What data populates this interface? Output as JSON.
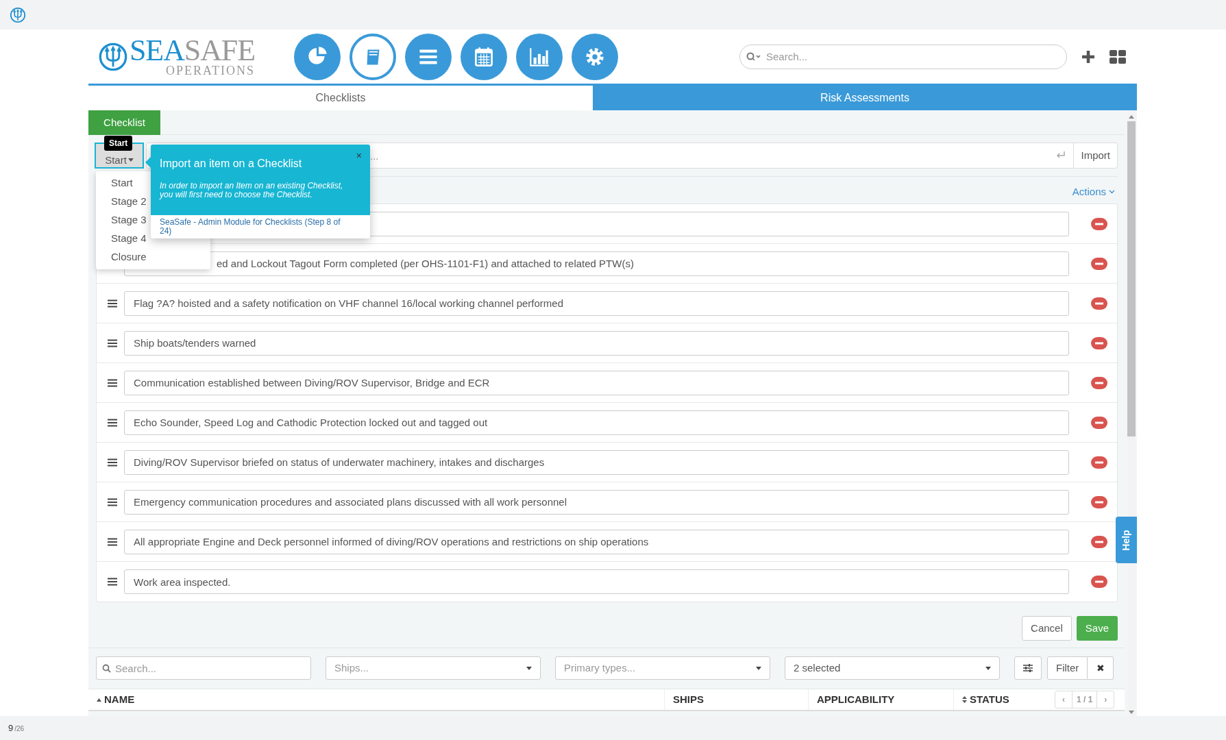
{
  "brand": {
    "name_part_1": "SEA",
    "name_part_2": "SAFE",
    "tagline": "OPERATIONS"
  },
  "search": {
    "placeholder": "Search..."
  },
  "tabs": [
    {
      "label": "Checklists",
      "selected": true
    },
    {
      "label": "Risk Assessments",
      "selected": false
    }
  ],
  "section_button": "Checklist",
  "stage_select": {
    "value": "Start",
    "tooltip": "Start",
    "options": [
      "Start",
      "Stage 2",
      "Stage 3",
      "Stage 4",
      "Closure"
    ]
  },
  "import_field": {
    "placeholder": "...",
    "button": "Import"
  },
  "actions": "Actions",
  "items": [
    {
      "kind": "blank"
    },
    {
      "kind": "partial",
      "text": "ed and Lockout Tagout Form completed (per OHS-1101-F1) and attached to related PTW(s)"
    },
    {
      "kind": "text",
      "text": "Flag ?A? hoisted and a safety notification on VHF channel 16/local working channel performed"
    },
    {
      "kind": "text",
      "text": "Ship boats/tenders warned"
    },
    {
      "kind": "text",
      "text": "Communication established between Diving/ROV Supervisor, Bridge and ECR"
    },
    {
      "kind": "text",
      "text": "Echo Sounder, Speed Log and Cathodic Protection locked out and tagged out"
    },
    {
      "kind": "text",
      "text": "Diving/ROV Supervisor briefed on status of underwater machinery, intakes and discharges"
    },
    {
      "kind": "text",
      "text": "Emergency communication procedures and associated plans discussed with all work personnel"
    },
    {
      "kind": "text",
      "text": "All appropriate Engine and Deck personnel informed of diving/ROV operations and restrictions on ship operations"
    },
    {
      "kind": "text",
      "text": "Work area inspected."
    }
  ],
  "popover": {
    "close": "×",
    "title": "Import an item on a Checklist",
    "body": "In order to import an Item on an existing Checklist, you will first need to choose the Checklist.",
    "link": "SeaSafe - Admin Module for Checklists (Step 8 of 24)"
  },
  "form_buttons": {
    "cancel": "Cancel",
    "save": "Save"
  },
  "filters": {
    "search_placeholder": "Search...",
    "ships": "Ships...",
    "primary_types": "Primary types...",
    "status": "2 selected",
    "filter_button": "Filter",
    "clear_button": "✖"
  },
  "columns": [
    {
      "label": "NAME",
      "sorted": true
    },
    {
      "label": "SHIPS",
      "sorted": false,
      "sortable": false
    },
    {
      "label": "APPLICABILITY",
      "sorted": false,
      "sortable": false
    },
    {
      "label": "STATUS",
      "sorted": false,
      "sortable": true
    }
  ],
  "pagination": {
    "prev": "‹",
    "page": "1 / 1",
    "next": "›"
  },
  "help": "Help",
  "page_indicator": {
    "current": "9",
    "total": "/26"
  }
}
